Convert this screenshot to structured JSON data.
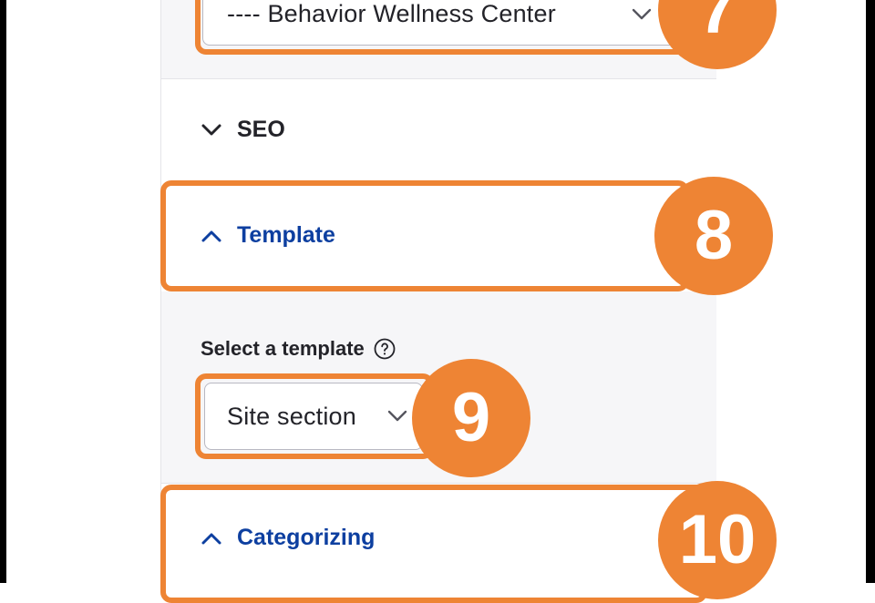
{
  "location_select": {
    "value": "---- Behavior Wellness Center"
  },
  "sections": {
    "seo": {
      "label": "SEO"
    },
    "template": {
      "label": "Template"
    },
    "categorizing": {
      "label": "Categorizing"
    }
  },
  "template_field": {
    "label": "Select a template",
    "value": "Site section"
  },
  "callouts": {
    "c7": "7",
    "c8": "8",
    "c9": "9",
    "c10": "10"
  },
  "colors": {
    "callout": "#ee8434",
    "section_active": "#0d3fa0"
  }
}
